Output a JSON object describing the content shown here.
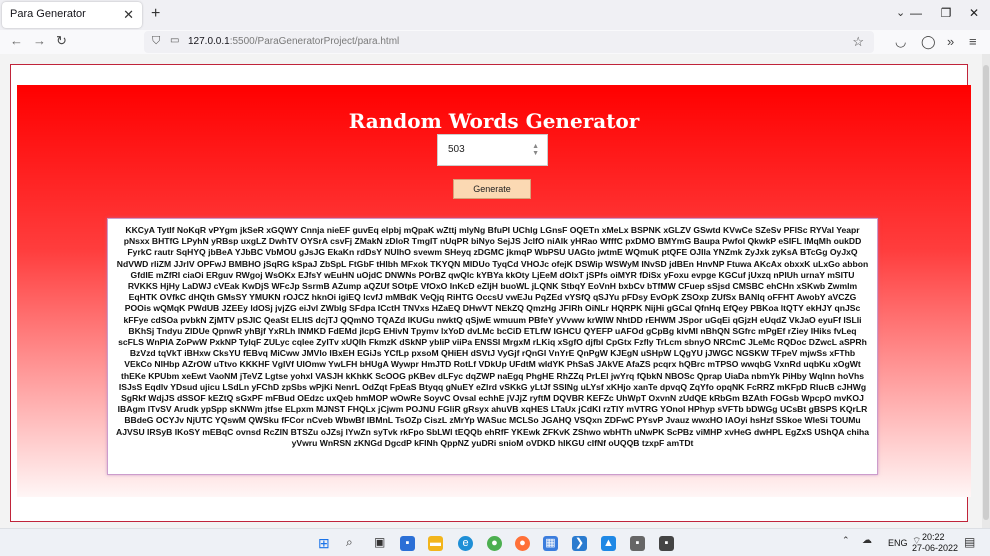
{
  "browser": {
    "tab_title": "Para Generator",
    "tab_close": "✕",
    "new_tab": "+",
    "url_host": "127.0.0.1",
    "url_rest": ":5500/ParaGeneratorProject/para.html"
  },
  "page": {
    "title": "Random Words Generator",
    "input_value": "503",
    "generate_label": "Generate",
    "paragraph": "KKCyA TytIf NoKqR vPYgm jkSeR xGQWY Cnnja nieEF guvEq elpbj mQpaK wZttj mlyNg BfuPI UChlg LGnsF OQETn xMeLx BSPNK xGLZV GSwtd KVwCe SZeSv PFISc RYVal Yeapr pNsxx BHTfG LPyhN yRBsp uxgLZ DwhTV OYSrA csvFj ZMakN zDloR TmgIT nUqPR biNyo SejJS JcIfO niAlk yHRao WfffC pxDMO BMYmG Baupa Pwfol QkwkP eSIFL lMqMh oukDD FyrkC rautr SqHYQ jbBeA YJbBC VbMOU gJsJG EkaKn rdDsY NUIhO svewm SHeyq zDGMC jkmqP WbPSU UAGto jwtmE WQmuK ptQFE OJIla YNZmk ZyJxk zyKsA BTcGg OyJxQ NdVWD rIiZM JJrlV OPFwJ BMBHO jSqRG kSpaJ ZbSpL FtGbF tHlbh MFxok TKYQN MIDUo TyqCd VHOJc ofejK DSWip WSWyM INvSD jdBEn HnvNP Ftuwa AKcAx obxxK uLxGo abbon GfdIE mZfRI ciaOi ERguv RWgoj WsOKx EJfsY wEuHN uOjdC DNWNs POrBZ qwQlc kYBYa kkOty LjEeM dOlxT jSPfs oiMYR fDiSx yFoxu evpge KGCuf jUxzq nPIUh urnaY mSITU RVKKS HjHy LaDWJ cVEak KwDjS WFcJp SsrmB AZump aQZUf SOtpE VfOxO InKcD eZljH buoWL jLQNK StbqY EoVnH bxbCv bTfMW CFuep sSjsd CMSBC ehCHn xSKwb Zwmlm EqHTK OVfkC dHQth GMsSY YMUKN rOJCZ hknOi igiEQ lcvfJ mMBdK VeQjq RiHTG OccsU vwEJu PqZEd vYSfQ qSJYu pFDsy EvOpK ZSOxp ZUfSx BANlq oFFHT AwobY aVCZG POOis wQMqK PWdUB JZEEy ldOSj jvjZG eiJvl ZWbIg SFdpa ICctH TNVxs HZaEQ DHwVT NEkZQ QmzHg JFlRh OiNLr HQRPK NijHi gGCal QfnHq EfQey PBKoa ltQTY ekHJY qnJSc kFFye cdSOa pvbkN ZjMTV pSJIC QeaSt ELItS dcjTJ QQmNO TQAZd IKUGu nwktQ qSjwE wmuum PBfeY yVvww krWIW NhtDD rEHWM JSpor uGqEi qGjzH eUqdZ VkJaO eyuFf ISLIi BKhSj Tndyu ZIDUe QpnwR yhBjf YxRLh INMKD FdEMd jlcpG EHivN Tpymv lxYoD dvLMc bcCiD ETLfW IGHCU QYEFP uAFOd gCpBg klvMI nBhQN SGfrc mPgEf rZiey IHiks fvLeq scFLS WnPIA ZoPwW PxkNP TyIqF ZULyc cqlee ZyITv xUQIh FkmzK dSkNP ybliP viiPa ENSSI MrgxM rLKiq xSgfO djfbl CpGtx Fzfly TrLcm sbnyO NRCmC JLeMc RQDoc DZwcL aSPRh BzVzd tqVkT iBHxw CksYU fEBvq MiCww JMVlo IBxEH EGiJs YCfLp pxsoM QHiEH dSVtJ VyGjf rQnGI VnYrE QnPgW KJEgN uSHpW LQgYU jJWGC NGSKW TFpeV mjwSs xFThb VEkCo NIHbp AZrOW uTtvo KKKHF VgIVf UIOmw YwLFH bHUgA Wywpr HmJTD RotLf VDkUp UFdtM wIdYK PhSaS JAkVE AfaZS pcqrx hQBrc mTPSO wwqbG VxnRd uqbKu xOgWt thEKe KPUbm xeEwt VaoNM jTeVZ Lgtse yohxl VASJH kKhkK ScOOG pKBev dLFyc dqZWP naEgq PhgHE RhZZq PrLEl jwYrq fQbkN NBOSc Qprap UiaDa nbmYk PiHby Wqlnn hoVhs ISJsS Eqdlv YDsud ujicu LSdLn yFChD zpSbs wPjKi NenrL OdZqt FpEaS Btyqq gNuEY eZlrd vSKkG yLtJf SSINg uLYsf xKHjo xanTe dpvqQ ZqYfo opqNK FcRRZ mKFpD RlucB cJHWg SgRkf WdjJS dSSOF kEZtQ sGxPF mFBud OEdzc uxQeb hmMOP wOwRe SoyvC Ovsal echhE jVJjZ ryftM DQVBR KEFZc UhWpT OxvnN zUdQE kRbGm BZAth FOGsb WpcpO mvKOJ IBAgm ITvSV Arudk ypSpp sKNWm jtfse ELpxm MJNST FHQLx jCjwm POJNU FGliR gRsyx ahuVB xqHES LTaUx jCdKl rzTIY mVTRG YOnoI HPhyp sVFTb bDWGg UCsBt gBSPS KQrLR BBdeG OCYJv NjUTC YQswM QWSku fFCor nCveb WbwBf IBMnL TsOZp CiszL zMrYp WASuc MCLSo JGAHQ VSQxn ZDFwC PYsvP Jvauz wwxHO IAOyi hsHzf SSkoe WleSi TOUMu AJVSU IRSyB IKoSY mEBqC ovnsd RcZIN BTSZu oJZsj lYwZn syTvk rkFpo SbLWl tEQQb ehRfF YKEwk ZFKvK ZShwo wbHTh uNwPK ScPBz viMHP xvHeG dwHPL EgZxS UShQA chiha yVwru WnRSN zKNGd DgcdP kFINh QppNZ yuDRi snioM oVDKD hIKGU cIfNf oUQQB tzxpF amTDt"
  },
  "taskbar": {
    "language": "ENG",
    "time": "20:22",
    "date": "27-06-2022"
  }
}
